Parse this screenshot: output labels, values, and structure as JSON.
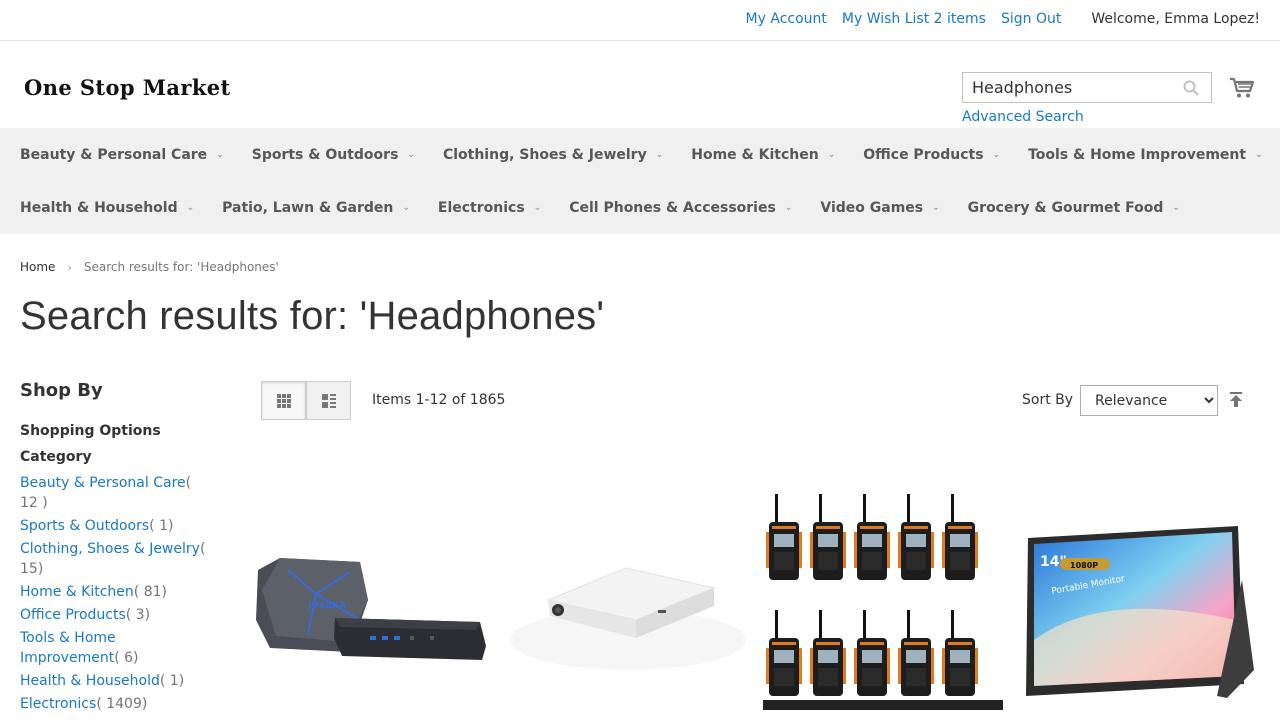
{
  "header": {
    "links": {
      "account": "My Account",
      "wishlist": "My Wish List 2 items",
      "signout": "Sign Out"
    },
    "welcome": "Welcome, Emma Lopez!",
    "logo": "One Stop Market",
    "search": {
      "value": "Headphones"
    },
    "advanced_search": "Advanced Search"
  },
  "nav": {
    "row1": [
      "Beauty & Personal Care",
      "Sports & Outdoors",
      "Clothing, Shoes & Jewelry",
      "Home & Kitchen",
      "Office Products",
      "Tools & Home Improvement"
    ],
    "row2": [
      "Health & Household",
      "Patio, Lawn & Garden",
      "Electronics",
      "Cell Phones & Accessories",
      "Video Games",
      "Grocery & Gourmet Food"
    ]
  },
  "breadcrumb": {
    "home": "Home",
    "current": "Search results for: 'Headphones'"
  },
  "page_title": "Search results for: 'Headphones'",
  "sidebar": {
    "shop_by": "Shop By",
    "shopping_options": "Shopping Options",
    "category_title": "Category",
    "categories": [
      {
        "name": "Beauty & Personal Care",
        "count": "( 12 )"
      },
      {
        "name": "Sports & Outdoors",
        "count": "( 1)"
      },
      {
        "name": "Clothing, Shoes & Jewelry",
        "count": "( 15)"
      },
      {
        "name": "Home & Kitchen",
        "count": "( 81)"
      },
      {
        "name": "Office Products",
        "count": "( 3)"
      },
      {
        "name": "Tools & Home Improvement",
        "count": "( 6)"
      },
      {
        "name": "Health & Household",
        "count": "( 1)"
      },
      {
        "name": "Electronics",
        "count": "( 1409)"
      }
    ]
  },
  "toolbar": {
    "items_count": "Items 1-12 of 1865",
    "sort_label": "Sort By",
    "sort_selected": "Relevance"
  },
  "products": [
    {
      "icon": "mini-pc-image"
    },
    {
      "icon": "projector-image"
    },
    {
      "icon": "walkie-talkie-set-image"
    },
    {
      "icon": "portable-monitor-image",
      "monitor_badge": "14\"",
      "monitor_res": "1080P",
      "monitor_text": "Portable Monitor"
    }
  ],
  "colors": {
    "link": "#1979c3",
    "nav_bg": "#f0f0f0"
  }
}
